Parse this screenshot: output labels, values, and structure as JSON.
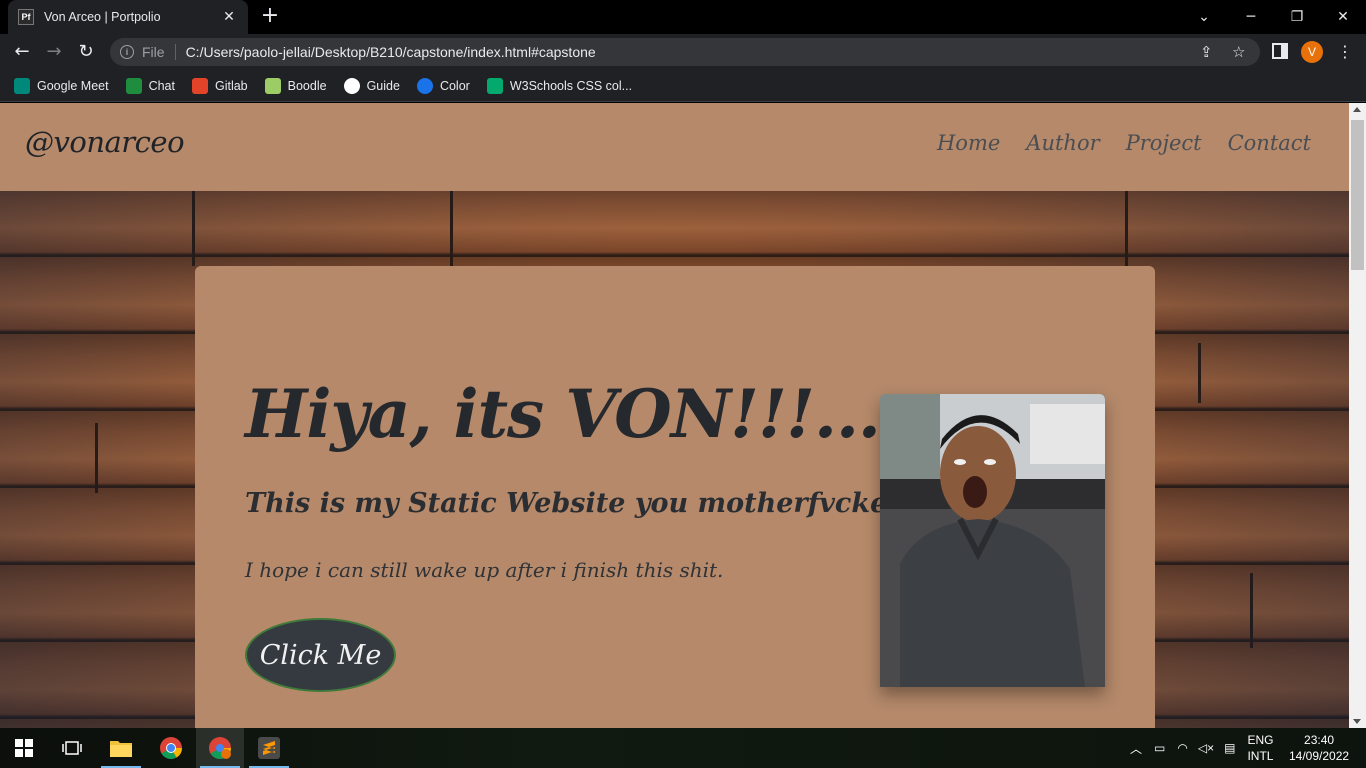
{
  "browser": {
    "tab_title": "Von Arceo | Portpolio",
    "tab_favicon_text": "Pf",
    "new_tab_symbol": "+",
    "omnibox": {
      "scheme_label": "File",
      "url": "C:/Users/paolo-jellai/Desktop/B210/capstone/index.html#capstone"
    },
    "profile_initial": "V",
    "bookmarks": [
      {
        "label": "Google Meet",
        "icon": "google-meet-icon",
        "color": "#00897b"
      },
      {
        "label": "Chat",
        "icon": "chat-icon",
        "color": "#1e8e3e"
      },
      {
        "label": "Gitlab",
        "icon": "gitlab-icon",
        "color": "#e24329"
      },
      {
        "label": "Boodle",
        "icon": "boodle-icon",
        "color": "#8bc34a"
      },
      {
        "label": "Guide",
        "icon": "globe-icon",
        "color": "#ffffff"
      },
      {
        "label": "Color",
        "icon": "color-icon",
        "color": "#1a73e8"
      },
      {
        "label": "W3Schools CSS col...",
        "icon": "w3schools-icon",
        "color": "#04aa6d"
      }
    ]
  },
  "site": {
    "brand": "@vonarceo",
    "nav": [
      "Home",
      "Author",
      "Project",
      "Contact"
    ],
    "hero": {
      "headline": "Hiya, its VON!!!...",
      "subheading": "This is my Static Website you motherfvcker",
      "tagline": "I hope i can still wake up after i finish this shit.",
      "button_label": "Click Me"
    }
  },
  "taskbar": {
    "language": "ENG",
    "layout": "INTL",
    "time": "23:40",
    "date": "14/09/2022"
  },
  "colors": {
    "card": "#b5896a",
    "button": "#343a40",
    "chrome": "#202124"
  }
}
